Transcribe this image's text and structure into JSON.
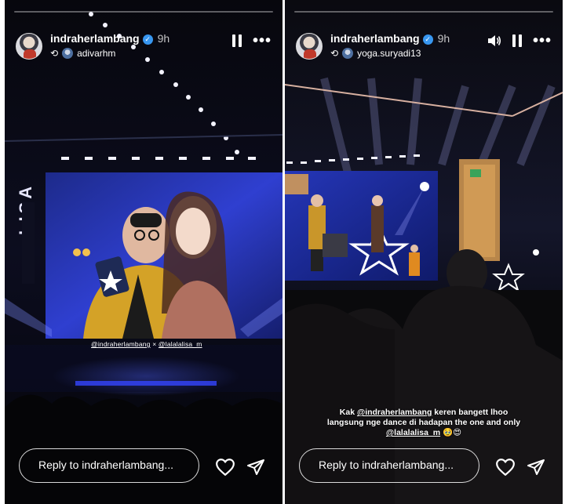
{
  "stories": [
    {
      "username": "indraherlambang",
      "time": "9h",
      "reshared_from": "adivarhm",
      "progress": 0.0,
      "screen_tag_user": "@indraherlambang",
      "screen_tag_sep": "×",
      "screen_tag_user2": "@lalalalisa_m",
      "stage_banner": "LISA",
      "reply_placeholder": "Reply to indraherlambang...",
      "icons": [
        "verified-icon",
        "repost-icon",
        "pause-icon",
        "more-icon",
        "heart-icon",
        "send-icon"
      ]
    },
    {
      "username": "indraherlambang",
      "time": "9h",
      "reshared_from": "yoga.suryadi13",
      "progress": 0.0,
      "caption": {
        "line1_prefix": "Kak ",
        "line1_mention": "@indraherlambang",
        "line1_suffix": " keren bangett lhoo",
        "line2": "langsung nge dance di hadapan the one and only",
        "line3_mention": "@lalalalisa_m",
        "line3_emoji": " 🥹😍"
      },
      "reply_placeholder": "Reply to indraherlambang...",
      "icons": [
        "verified-icon",
        "repost-icon",
        "speaker-icon",
        "pause-icon",
        "more-icon",
        "heart-icon",
        "send-icon"
      ]
    }
  ],
  "colors": {
    "verified": "#3897f0",
    "stage_blue": "#2b3cff",
    "background": "#0b0b12"
  }
}
